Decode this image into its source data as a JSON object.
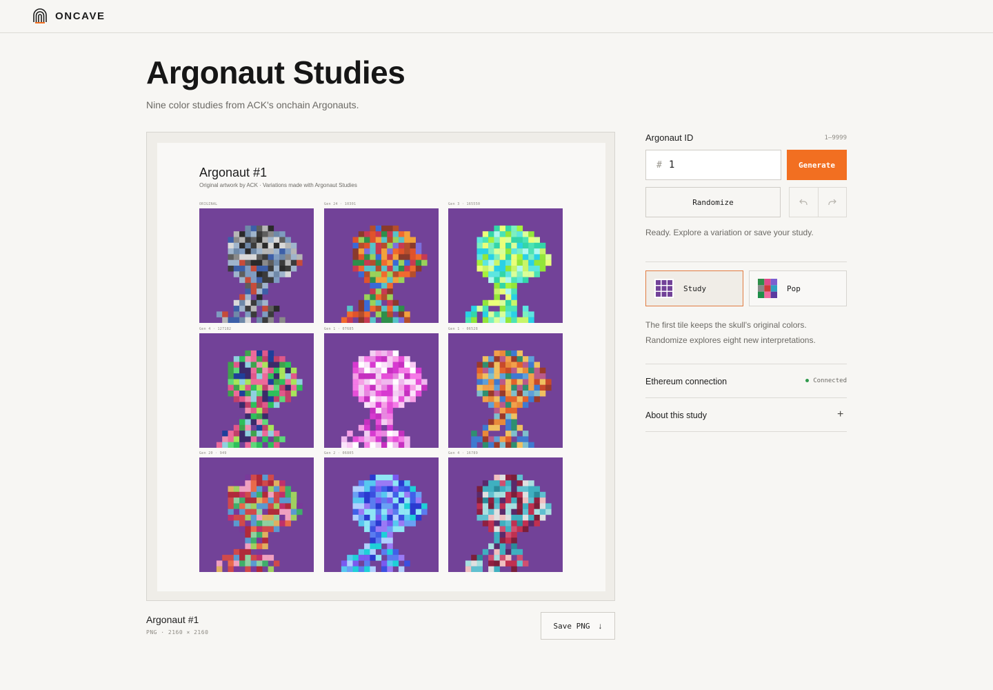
{
  "app": {
    "brand": "ONCAVE"
  },
  "page": {
    "title": "Argonaut Studies",
    "subtitle": "Nine color studies from ACK's onchain Argonauts."
  },
  "artwork": {
    "title": "Argonaut #1",
    "subtitle": "Original artwork by ACK · Variations made with Argonaut Studies",
    "tile_bg": "#724298",
    "tiles": [
      {
        "label": "ORIGINAL",
        "palette": [
          "#7f9cc0",
          "#9fb4cc",
          "#6f89a8",
          "#b6b6b6",
          "#8a8a8a",
          "#5e5e5e",
          "#3b3b3b",
          "#2a2a2a",
          "#d9d9d9",
          "#3d5fa8",
          "#c64c3a"
        ]
      },
      {
        "label": "Gen 24 · 10301",
        "palette": [
          "#e0532b",
          "#2e8f4a",
          "#7b6fdc",
          "#b54e2c",
          "#f2a23c",
          "#c83a52",
          "#3a6ad6",
          "#9ad25a",
          "#57c3c9",
          "#8a3a2b",
          "#f06a2e"
        ]
      },
      {
        "label": "Gen 3 · 165550",
        "palette": [
          "#a6f23c",
          "#c8f56a",
          "#5de6e0",
          "#33d6a8",
          "#eaff7a",
          "#7cf0c0",
          "#2ad1e6",
          "#93e63a",
          "#d9ff9a",
          "#4be3b5",
          "#b0f7f0"
        ]
      },
      {
        "label": "Gen 4 · 127182",
        "palette": [
          "#e0588a",
          "#2fbf5b",
          "#ec6a9a",
          "#3fa34d",
          "#a8e55a",
          "#c0406a",
          "#5fd87a",
          "#1f3f9a",
          "#f08fb0",
          "#3b2a6a",
          "#8fd0e0"
        ]
      },
      {
        "label": "Gen 1 · 07685",
        "palette": [
          "#f6a0e6",
          "#f0b8ee",
          "#e64fd8",
          "#ffffff",
          "#f3d0f2",
          "#d73ad0",
          "#fac8f4",
          "#e888e0",
          "#fbe4fa",
          "#c630c0",
          "#f57ae6"
        ]
      },
      {
        "label": "Gen 1 · 06528",
        "palette": [
          "#e2622b",
          "#7fbfcc",
          "#3f7ad0",
          "#c84a2a",
          "#f2a04a",
          "#2f8f70",
          "#9a3a2a",
          "#5fa0d8",
          "#e88a3a",
          "#b95a8a",
          "#f0c060"
        ]
      },
      {
        "label": "Gen 20 · 949",
        "palette": [
          "#c0306a",
          "#8fd0a0",
          "#e86a4a",
          "#3fae6a",
          "#f0a0c0",
          "#7a3a9a",
          "#d04a4a",
          "#a0d060",
          "#e0b060",
          "#5a9ad0",
          "#b02a3a"
        ]
      },
      {
        "label": "Gen 2 · 06805",
        "palette": [
          "#5a7cf0",
          "#3b4fe0",
          "#7a5af0",
          "#57c8f0",
          "#8fe6f5",
          "#2a3ad0",
          "#9a7af5",
          "#1fd0d8",
          "#6aa0f5",
          "#4060e8",
          "#b0d0ff"
        ]
      },
      {
        "label": "Gen 4 · 16789",
        "palette": [
          "#7a1f3a",
          "#3fb0c0",
          "#e0e0e0",
          "#c03050",
          "#2a8a9a",
          "#f0c0c0",
          "#5a2a6a",
          "#a8e0e0",
          "#902040",
          "#60c0d0",
          "#d05070"
        ]
      }
    ]
  },
  "caption": {
    "title": "Argonaut #1",
    "meta": "PNG · 2160 × 2160",
    "save_label": "Save PNG"
  },
  "sidebar": {
    "id_label": "Argonaut ID",
    "id_range": "1–9999",
    "id_prefix": "#",
    "id_value": "1",
    "generate_label": "Generate",
    "randomize_label": "Randomize",
    "status": "Ready. Explore a variation or save your study.",
    "modes": [
      {
        "label": "Study",
        "active": true
      },
      {
        "label": "Pop",
        "active": false
      }
    ],
    "description_1": "The first tile keeps the skull's original colors.",
    "description_2": "Randomize explores eight new interpretations.",
    "eth_label": "Ethereum connection",
    "eth_status": "Connected",
    "about_label": "About this study"
  },
  "colors": {
    "accent": "#f26f21",
    "tile_purple": "#724298",
    "connected": "#2f9a4c"
  }
}
